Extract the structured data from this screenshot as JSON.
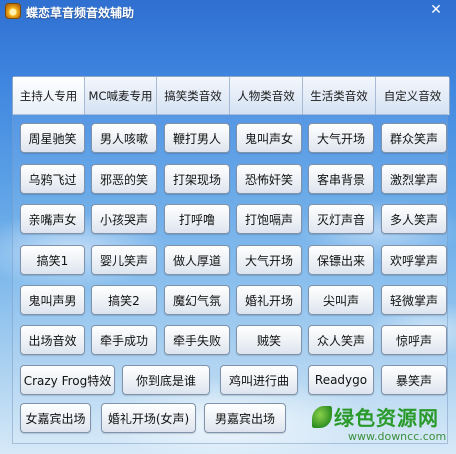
{
  "window": {
    "title": "蝶恋草音频音效辅助",
    "close_glyph": "✕"
  },
  "tabs": [
    {
      "label": "主持人专用",
      "active": true
    },
    {
      "label": "MC喊麦专用",
      "active": false
    },
    {
      "label": "搞笑类音效",
      "active": false
    },
    {
      "label": "人物类音效",
      "active": false
    },
    {
      "label": "生活类音效",
      "active": false
    },
    {
      "label": "自定义音效",
      "active": false
    }
  ],
  "buttons": [
    [
      "周星驰笑",
      "男人咳嗽",
      "鞭打男人",
      "鬼叫声女",
      "大气开场",
      "群众笑声"
    ],
    [
      "乌鸦飞过",
      "邪恶的笑",
      "打架现场",
      "恐怖奸笑",
      "客串背景",
      "激烈掌声"
    ],
    [
      "亲嘴声女",
      "小孩哭声",
      "打呼噜",
      "打饱嗝声",
      "灭灯声音",
      "多人笑声"
    ],
    [
      "搞笑1",
      "婴儿笑声",
      "做人厚道",
      "大气开场",
      "保镖出来",
      "欢呼掌声"
    ],
    [
      "鬼叫声男",
      "搞笑2",
      "魔幻气氛",
      "婚礼开场",
      "尖叫声",
      "轻微掌声"
    ],
    [
      "出场音效",
      "牵手成功",
      "牵手失败",
      "贼笑",
      "众人笑声",
      "惊呼声"
    ],
    [
      "Crazy Frog特效",
      "你到底是谁",
      "鸡叫进行曲",
      "Readygo",
      "暴笑声"
    ],
    [
      "女嘉宾出场",
      "婚礼开场(女声)",
      "男嘉宾出场"
    ]
  ],
  "watermark": {
    "name": "绿色资源网",
    "url": "www.downcc.com"
  }
}
